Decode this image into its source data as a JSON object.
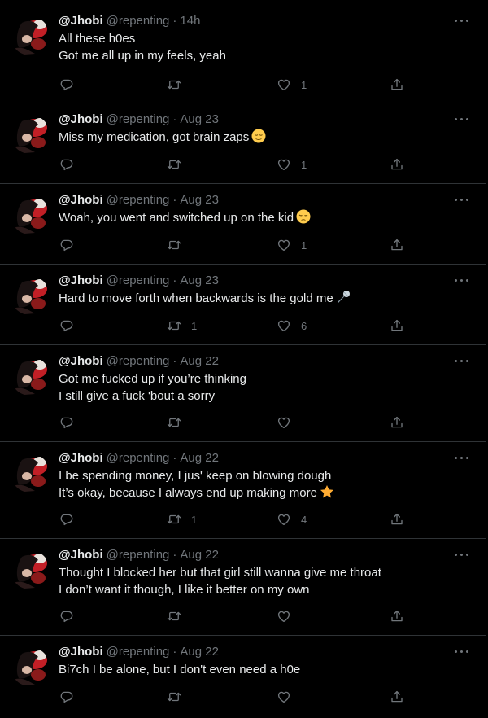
{
  "tweets": [
    {
      "name": "@Jhobi",
      "handle": "@repenting",
      "sep": "·",
      "time": "14h",
      "lines": [
        "All these h0es",
        "Got me all up in my feels, yeah"
      ],
      "reply_count": "",
      "retweet_count": "",
      "like_count": "1"
    },
    {
      "name": "@Jhobi",
      "handle": "@repenting",
      "sep": "·",
      "time": "Aug 23",
      "lines": [
        "Miss my medication, got brain zaps"
      ],
      "emoji": "relieved-face",
      "reply_count": "",
      "retweet_count": "",
      "like_count": "1"
    },
    {
      "name": "@Jhobi",
      "handle": "@repenting",
      "sep": "·",
      "time": "Aug 23",
      "lines": [
        "Woah, you went and switched up on the kid"
      ],
      "emoji": "pensive-face",
      "reply_count": "",
      "retweet_count": "",
      "like_count": "1"
    },
    {
      "name": "@Jhobi",
      "handle": "@repenting",
      "sep": "·",
      "time": "Aug 23",
      "lines": [
        "Hard to move forth when backwards is the gold me"
      ],
      "emoji": "microphone",
      "reply_count": "",
      "retweet_count": "1",
      "like_count": "6"
    },
    {
      "name": "@Jhobi",
      "handle": "@repenting",
      "sep": "·",
      "time": "Aug 22",
      "lines": [
        "Got me fucked up if you’re thinking",
        "I still give a fuck 'bout a sorry"
      ],
      "reply_count": "",
      "retweet_count": "",
      "like_count": ""
    },
    {
      "name": "@Jhobi",
      "handle": "@repenting",
      "sep": "·",
      "time": "Aug 22",
      "lines": [
        "I be spending money, I jus' keep on blowing dough",
        "It’s okay, because I always end up making more"
      ],
      "emoji": "star",
      "reply_count": "",
      "retweet_count": "1",
      "like_count": "4"
    },
    {
      "name": "@Jhobi",
      "handle": "@repenting",
      "sep": "·",
      "time": "Aug 22",
      "lines": [
        "Thought I blocked her but that girl still wanna give me throat",
        "I don’t want it though, I like it better on my own"
      ],
      "reply_count": "",
      "retweet_count": "",
      "like_count": ""
    },
    {
      "name": "@Jhobi",
      "handle": "@repenting",
      "sep": "·",
      "time": "Aug 22",
      "lines": [
        "Bi7ch I be alone, but I don't even need a h0e"
      ],
      "reply_count": "",
      "retweet_count": "",
      "like_count": ""
    }
  ],
  "colors": {
    "background": "#000000",
    "text": "#e7e9ea",
    "muted": "#71767b",
    "divider": "#2f3336"
  }
}
